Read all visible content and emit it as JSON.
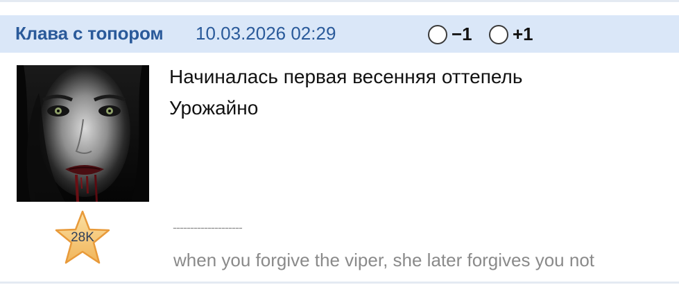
{
  "post": {
    "author": "Клава с топором",
    "timestamp": "10.03.2026 02:29",
    "votes": {
      "minus_label": "−1",
      "plus_label": "+1"
    },
    "rank_badge": "28K",
    "message_lines": [
      "Начиналась первая весенняя оттепель",
      "Урожайно"
    ],
    "signature_divider": "--------------------",
    "signature": "when you forgive the viper, she later forgives you not"
  },
  "colors": {
    "header_bg": "#dae7f8",
    "author_text": "#2a5a9a",
    "star_fill": "#f5c97a",
    "star_stroke": "#e89a3a"
  },
  "icons": {
    "avatar": "portrait-image",
    "rank": "star-icon",
    "vote_minus": "radio-button",
    "vote_plus": "radio-button"
  }
}
